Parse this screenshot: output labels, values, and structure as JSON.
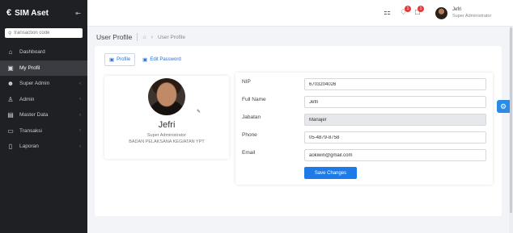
{
  "app": {
    "title": "SIM Aset",
    "logo_glyph": "€",
    "collapse_glyph": "⇤"
  },
  "search": {
    "placeholder": "transaction code",
    "icon": "search-icon"
  },
  "sidebar": {
    "items": [
      {
        "label": "Dashboard",
        "icon": "home-icon",
        "glyph": "⌂",
        "chevron": false,
        "active": false
      },
      {
        "label": "My Profil",
        "icon": "profile-card-icon",
        "glyph": "▣",
        "chevron": false,
        "active": true
      },
      {
        "label": "Super Admin",
        "icon": "users-icon",
        "glyph": "☻",
        "chevron": true,
        "active": false
      },
      {
        "label": "Admin",
        "icon": "user-icon",
        "glyph": "♙",
        "chevron": true,
        "active": false
      },
      {
        "label": "Master Data",
        "icon": "database-icon",
        "glyph": "▤",
        "chevron": true,
        "active": false
      },
      {
        "label": "Transaksi",
        "icon": "transaction-icon",
        "glyph": "▭",
        "chevron": true,
        "active": false
      },
      {
        "label": "Laporan",
        "icon": "report-icon",
        "glyph": "▯",
        "chevron": true,
        "active": false
      }
    ]
  },
  "topbar": {
    "apps_glyph": "⚏",
    "notification_badge": "1",
    "messages_badge": "1",
    "user_name": "Jefri",
    "user_role": "Super Administrator"
  },
  "breadcrumb": {
    "title": "User Profile",
    "home_glyph": "⌂",
    "arrow": "›",
    "current": "User Profile"
  },
  "tabs": [
    {
      "label": "Profile",
      "glyph": "▣"
    },
    {
      "label": "Edit Password",
      "glyph": "▣"
    }
  ],
  "profile": {
    "name": "Jefri",
    "role": "Super Administrator",
    "organization": "BADAN PELAKSANA KEGIATAN YPT",
    "edit_glyph": "✎"
  },
  "form": {
    "nip_label": "NIP",
    "nip_value": "6703204026",
    "fullname_label": "Full Name",
    "fullname_value": "Jefri",
    "jabatan_label": "Jabatan",
    "jabatan_value": "Manajer",
    "phone_label": "Phone",
    "phone_value": "05-4879-8758",
    "email_label": "Email",
    "email_value": "aokiwin@gmail.com",
    "save_label": "Save Changes"
  },
  "fab": {
    "glyph": "⚙"
  },
  "colors": {
    "sidebar": "#1f2024",
    "accent": "#1e7ae6",
    "badge": "#e23b3b"
  }
}
